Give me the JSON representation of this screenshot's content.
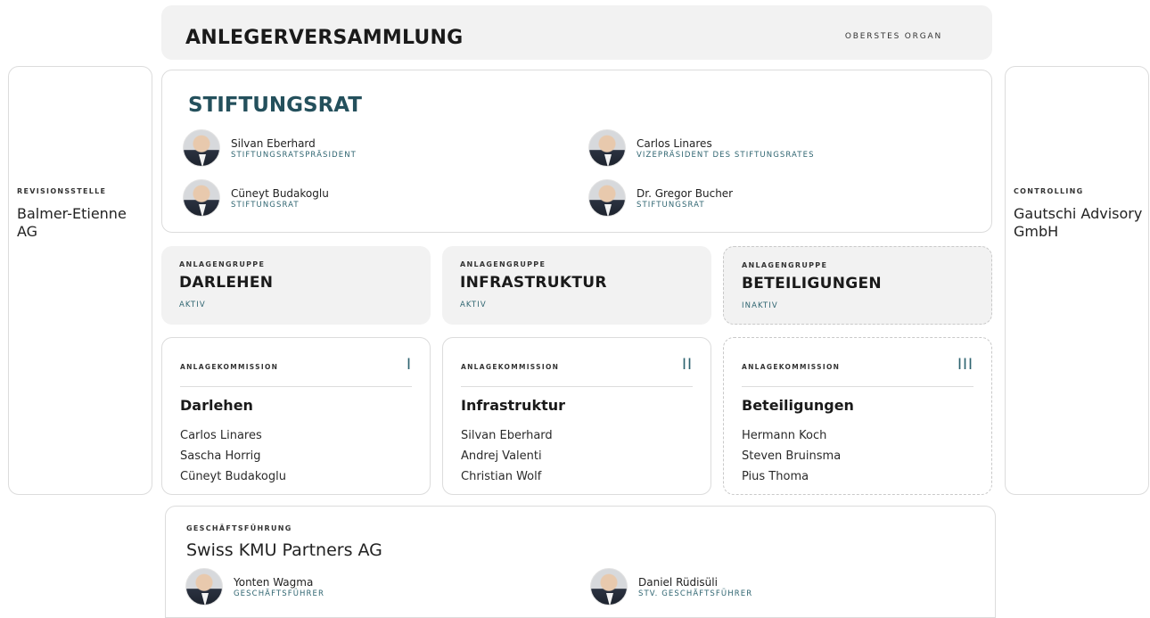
{
  "top": {
    "title": "ANLEGERVERSAMMLUNG",
    "tag": "OBERSTES ORGAN"
  },
  "left": {
    "label": "REVISIONSSTELLE",
    "value": "Balmer-Etienne AG"
  },
  "right": {
    "label": "CONTROLLING",
    "value": "Gautschi Advisory GmbH"
  },
  "board": {
    "title": "STIFTUNGSRAT",
    "members": [
      {
        "name": "Silvan Eberhard",
        "role": "STIFTUNGSRATSPRÄSIDENT"
      },
      {
        "name": "Carlos Linares",
        "role": "VIZEPRÄSIDENT DES STIFTUNGSRATES"
      },
      {
        "name": "Cüneyt Budakoglu",
        "role": "STIFTUNGSRAT"
      },
      {
        "name": "Dr. Gregor Bucher",
        "role": "STIFTUNGSRAT"
      }
    ]
  },
  "groups": [
    {
      "label": "ANLAGENGRUPPE",
      "name": "DARLEHEN",
      "status": "AKTIV"
    },
    {
      "label": "ANLAGENGRUPPE",
      "name": "INFRASTRUKTUR",
      "status": "AKTIV"
    },
    {
      "label": "ANLAGENGRUPPE",
      "name": "BETEILIGUNGEN",
      "status": "INAKTIV"
    }
  ],
  "commissions": [
    {
      "label": "ANLAGEKOMMISSION",
      "numeral": "I",
      "name": "Darlehen",
      "members": [
        "Carlos Linares",
        "Sascha Horrig",
        "Cüneyt Budakoglu"
      ]
    },
    {
      "label": "ANLAGEKOMMISSION",
      "numeral": "II",
      "name": "Infrastruktur",
      "members": [
        "Silvan Eberhard",
        "Andrej Valenti",
        "Christian Wolf"
      ]
    },
    {
      "label": "ANLAGEKOMMISSION",
      "numeral": "III",
      "name": "Beteiligungen",
      "members": [
        "Hermann Koch",
        "Steven Bruinsma",
        "Pius Thoma"
      ]
    }
  ],
  "management": {
    "label": "GESCHÄFTSFÜHRUNG",
    "company": "Swiss KMU Partners AG",
    "members": [
      {
        "name": "Yonten Wagma",
        "role": "GESCHÄFTSFÜHRER"
      },
      {
        "name": "Daniel Rüdisüli",
        "role": "STV. GESCHÄFTSFÜHRER"
      }
    ]
  },
  "colors": {
    "accent": "#2e6470",
    "heading_accent": "#24505c",
    "panel_grey": "#f2f2f2",
    "border": "#dcdcdc"
  },
  "icons": {
    "avatar": "person-portrait-icon"
  }
}
